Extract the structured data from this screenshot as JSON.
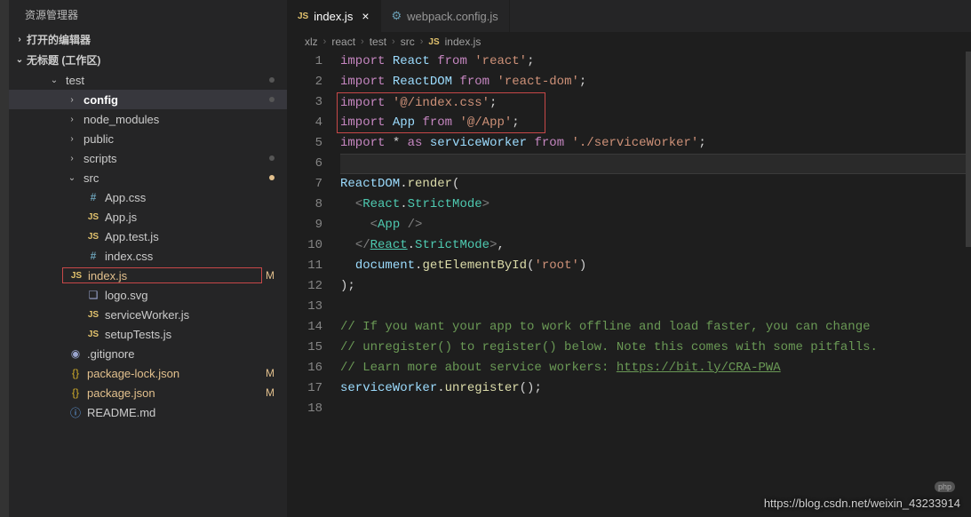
{
  "sidebar": {
    "title": "资源管理器",
    "openEditors": "打开的编辑器",
    "workspace": "无标题 (工作区)",
    "tree": [
      {
        "type": "folder",
        "label": "test",
        "indent": 42,
        "chev": "v",
        "dot": true
      },
      {
        "type": "folder",
        "label": "config",
        "indent": 62,
        "chev": ">",
        "active": true,
        "dot": true,
        "bold": true
      },
      {
        "type": "folder",
        "label": "node_modules",
        "indent": 62,
        "chev": ">"
      },
      {
        "type": "folder",
        "label": "public",
        "indent": 62,
        "chev": ">"
      },
      {
        "type": "folder",
        "label": "scripts",
        "indent": 62,
        "chev": ">",
        "dot": true,
        "dotcolor": "#565656"
      },
      {
        "type": "folder",
        "label": "src",
        "indent": 62,
        "chev": "v",
        "dot": true,
        "dotcolor": "#e2c08d"
      },
      {
        "type": "file",
        "label": "App.css",
        "indent": 86,
        "icon": "css",
        "iconText": "#"
      },
      {
        "type": "file",
        "label": "App.js",
        "indent": 86,
        "icon": "js",
        "iconText": "JS"
      },
      {
        "type": "file",
        "label": "App.test.js",
        "indent": 86,
        "icon": "js",
        "iconText": "JS"
      },
      {
        "type": "file",
        "label": "index.css",
        "indent": 86,
        "icon": "css",
        "iconText": "#"
      },
      {
        "type": "file",
        "label": "index.js",
        "indent": 86,
        "icon": "js",
        "iconText": "JS",
        "status": "M",
        "redbox": true,
        "modified": true
      },
      {
        "type": "file",
        "label": "logo.svg",
        "indent": 86,
        "icon": "svg",
        "iconText": "❑"
      },
      {
        "type": "file",
        "label": "serviceWorker.js",
        "indent": 86,
        "icon": "js",
        "iconText": "JS"
      },
      {
        "type": "file",
        "label": "setupTests.js",
        "indent": 86,
        "icon": "js",
        "iconText": "JS"
      },
      {
        "type": "file",
        "label": ".gitignore",
        "indent": 66,
        "icon": "git",
        "iconText": "◉"
      },
      {
        "type": "file",
        "label": "package-lock.json",
        "indent": 66,
        "icon": "json",
        "iconText": "{}",
        "status": "M",
        "modified": true
      },
      {
        "type": "file",
        "label": "package.json",
        "indent": 66,
        "icon": "json",
        "iconText": "{}",
        "status": "M",
        "modified": true
      },
      {
        "type": "file",
        "label": "README.md",
        "indent": 66,
        "icon": "md",
        "iconText": "ⓘ"
      }
    ]
  },
  "tabs": [
    {
      "label": "index.js",
      "icon": "JS",
      "active": true,
      "close": "×"
    },
    {
      "label": "webpack.config.js",
      "icon": "⚙",
      "active": false
    }
  ],
  "breadcrumb": [
    "xlz",
    "react",
    "test",
    "src",
    "index.js"
  ],
  "breadcrumbIcon": "JS",
  "code": {
    "lines": [
      {
        "n": 1,
        "tokens": [
          [
            "kw",
            "import"
          ],
          [
            "punct",
            " "
          ],
          [
            "var",
            "React"
          ],
          [
            "punct",
            " "
          ],
          [
            "kw",
            "from"
          ],
          [
            "punct",
            " "
          ],
          [
            "str",
            "'react'"
          ],
          [
            "punct",
            ";"
          ]
        ]
      },
      {
        "n": 2,
        "tokens": [
          [
            "kw",
            "import"
          ],
          [
            "punct",
            " "
          ],
          [
            "var",
            "ReactDOM"
          ],
          [
            "punct",
            " "
          ],
          [
            "kw",
            "from"
          ],
          [
            "punct",
            " "
          ],
          [
            "str",
            "'react-dom'"
          ],
          [
            "punct",
            ";"
          ]
        ]
      },
      {
        "n": 3,
        "boxTop": true,
        "tokens": [
          [
            "kw",
            "import"
          ],
          [
            "punct",
            " "
          ],
          [
            "str",
            "'@/index.css'"
          ],
          [
            "punct",
            ";"
          ]
        ]
      },
      {
        "n": 4,
        "boxBot": true,
        "tokens": [
          [
            "kw",
            "import"
          ],
          [
            "punct",
            " "
          ],
          [
            "var",
            "App"
          ],
          [
            "punct",
            " "
          ],
          [
            "kw",
            "from"
          ],
          [
            "punct",
            " "
          ],
          [
            "str",
            "'@/App'"
          ],
          [
            "punct",
            ";"
          ]
        ]
      },
      {
        "n": 5,
        "tokens": [
          [
            "kw",
            "import"
          ],
          [
            "punct",
            " "
          ],
          [
            "punct",
            "* "
          ],
          [
            "kw",
            "as"
          ],
          [
            "punct",
            " "
          ],
          [
            "var",
            "serviceWorker"
          ],
          [
            "punct",
            " "
          ],
          [
            "kw",
            "from"
          ],
          [
            "punct",
            " "
          ],
          [
            "str",
            "'./serviceWorker'"
          ],
          [
            "punct",
            ";"
          ]
        ]
      },
      {
        "n": 6,
        "current": true,
        "tokens": [
          [
            "punct",
            ""
          ]
        ]
      },
      {
        "n": 7,
        "tokens": [
          [
            "var",
            "ReactDOM"
          ],
          [
            "punct",
            "."
          ],
          [
            "fn",
            "render"
          ],
          [
            "punct",
            "("
          ]
        ]
      },
      {
        "n": 8,
        "tokens": [
          [
            "punct",
            "  "
          ],
          [
            "brack",
            "<"
          ],
          [
            "cls",
            "React"
          ],
          [
            "punct",
            "."
          ],
          [
            "cls",
            "StrictMode"
          ],
          [
            "brack",
            ">"
          ]
        ]
      },
      {
        "n": 9,
        "tokens": [
          [
            "punct",
            "    "
          ],
          [
            "brack",
            "<"
          ],
          [
            "cls",
            "App"
          ],
          [
            "punct",
            " "
          ],
          [
            "brack",
            "/>"
          ]
        ]
      },
      {
        "n": 10,
        "tokens": [
          [
            "punct",
            "  "
          ],
          [
            "brack",
            "</"
          ],
          [
            "cls underline",
            "React"
          ],
          [
            "punct",
            "."
          ],
          [
            "cls",
            "StrictMode"
          ],
          [
            "brack",
            ">"
          ],
          [
            "punct",
            ","
          ]
        ]
      },
      {
        "n": 11,
        "tokens": [
          [
            "punct",
            "  "
          ],
          [
            "var",
            "document"
          ],
          [
            "punct",
            "."
          ],
          [
            "fn",
            "getElementById"
          ],
          [
            "punct",
            "("
          ],
          [
            "str",
            "'root'"
          ],
          [
            "punct",
            ")"
          ]
        ]
      },
      {
        "n": 12,
        "tokens": [
          [
            "punct",
            ");"
          ]
        ]
      },
      {
        "n": 13,
        "tokens": [
          [
            "punct",
            ""
          ]
        ]
      },
      {
        "n": 14,
        "tokens": [
          [
            "comment",
            "// If you want your app to work offline and load faster, you can change"
          ]
        ]
      },
      {
        "n": 15,
        "tokens": [
          [
            "comment",
            "// unregister() to register() below. Note this comes with some pitfalls."
          ]
        ]
      },
      {
        "n": 16,
        "tokens": [
          [
            "comment",
            "// Learn more about service workers: "
          ],
          [
            "comment underline",
            "https://bit.ly/CRA-PWA"
          ]
        ]
      },
      {
        "n": 17,
        "tokens": [
          [
            "var",
            "serviceWorker"
          ],
          [
            "punct",
            "."
          ],
          [
            "fn",
            "unregister"
          ],
          [
            "punct",
            "();"
          ]
        ]
      },
      {
        "n": 18,
        "tokens": [
          [
            "punct",
            ""
          ]
        ]
      }
    ]
  },
  "watermark": "https://blog.csdn.net/weixin_43233914",
  "phpBadge": "php"
}
